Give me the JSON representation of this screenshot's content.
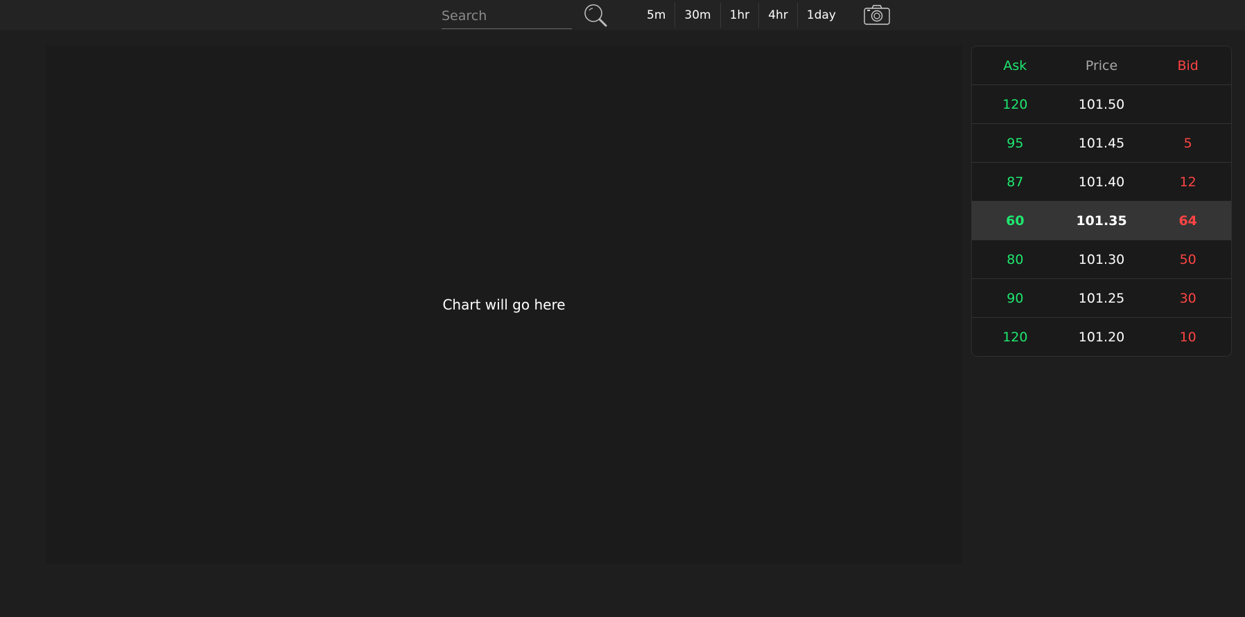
{
  "search": {
    "placeholder": "Search"
  },
  "timeframes": [
    "5m",
    "30m",
    "1hr",
    "4hr",
    "1day"
  ],
  "chart": {
    "placeholder": "Chart will go here"
  },
  "orderbook": {
    "headers": {
      "ask": "Ask",
      "price": "Price",
      "bid": "Bid"
    },
    "rows": [
      {
        "ask": "120",
        "price": "101.50",
        "bid": ""
      },
      {
        "ask": "95",
        "price": "101.45",
        "bid": "5"
      },
      {
        "ask": "87",
        "price": "101.40",
        "bid": "12"
      },
      {
        "ask": "60",
        "price": "101.35",
        "bid": "64"
      },
      {
        "ask": "80",
        "price": "101.30",
        "bid": "50"
      },
      {
        "ask": "90",
        "price": "101.25",
        "bid": "30"
      },
      {
        "ask": "120",
        "price": "101.20",
        "bid": "10"
      }
    ]
  },
  "colors": {
    "ask": "#1ee86f",
    "bid": "#ff4444",
    "background": "#1e1e1e",
    "highlight_row": "#353535"
  },
  "icons": {
    "search": "search-icon",
    "camera": "camera-icon"
  }
}
